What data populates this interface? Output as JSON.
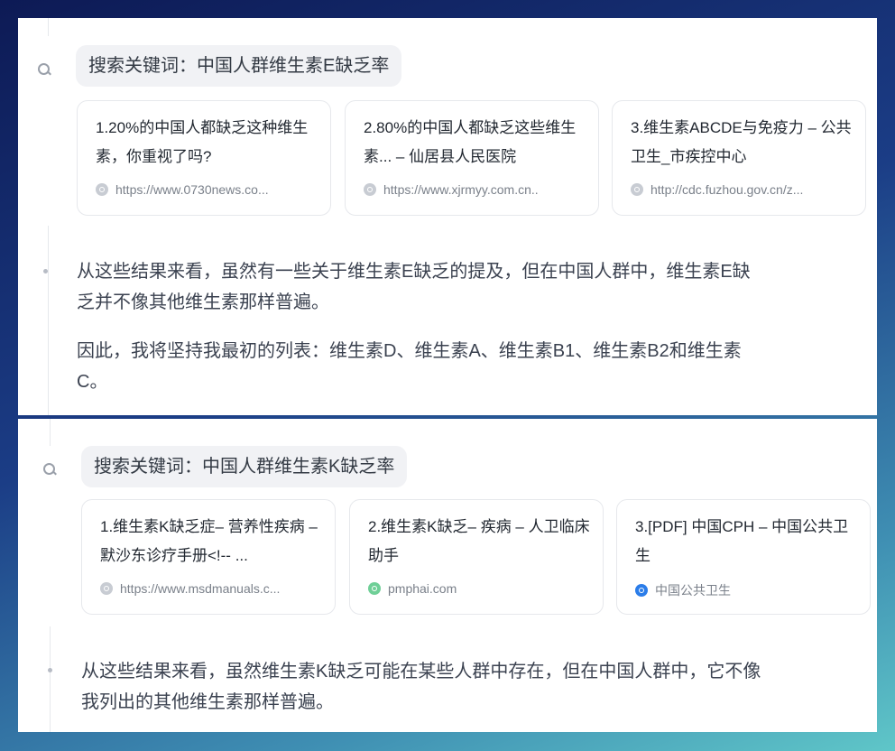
{
  "top": {
    "search_keyword": "搜索关键词：中国人群维生素E缺乏率",
    "cards": [
      {
        "title": "1.20%的中国人都缺乏这种维生素，你重视了吗?",
        "source": "https://www.0730news.co..."
      },
      {
        "title": "2.80%的中国人都缺乏这些维生素... – 仙居县人民医院",
        "source": "https://www.xjrmyy.com.cn.."
      },
      {
        "title": "3.维生素ABCDE与免疫力 – 公共卫生_市疾控中心",
        "source": "http://cdc.fuzhou.gov.cn/z..."
      }
    ],
    "paragraph1": "从这些结果来看，虽然有一些关于维生素E缺乏的提及，但在中国人群中，维生素E缺乏并不像其他维生素那样普遍。",
    "paragraph2": "因此，我将坚持我最初的列表：维生素D、维生素A、维生素B1、维生素B2和维生素C。"
  },
  "bottom": {
    "search_keyword": "搜索关键词：中国人群维生素K缺乏率",
    "cards": [
      {
        "title": "1.维生素K缺乏症– 营养性疾病 – 默沙东诊疗手册<!-- ...",
        "source": "https://www.msdmanuals.c..."
      },
      {
        "title": "2.维生素K缺乏– 疾病 – 人卫临床助手",
        "source": "pmphai.com"
      },
      {
        "title": "3.[PDF] 中国CPH – 中国公共卫生",
        "source": "中国公共卫生"
      }
    ],
    "paragraph1": "从这些结果来看，虽然维生素K缺乏可能在某些人群中存在，但在中国人群中，它不像我列出的其他维生素那样普遍。"
  }
}
